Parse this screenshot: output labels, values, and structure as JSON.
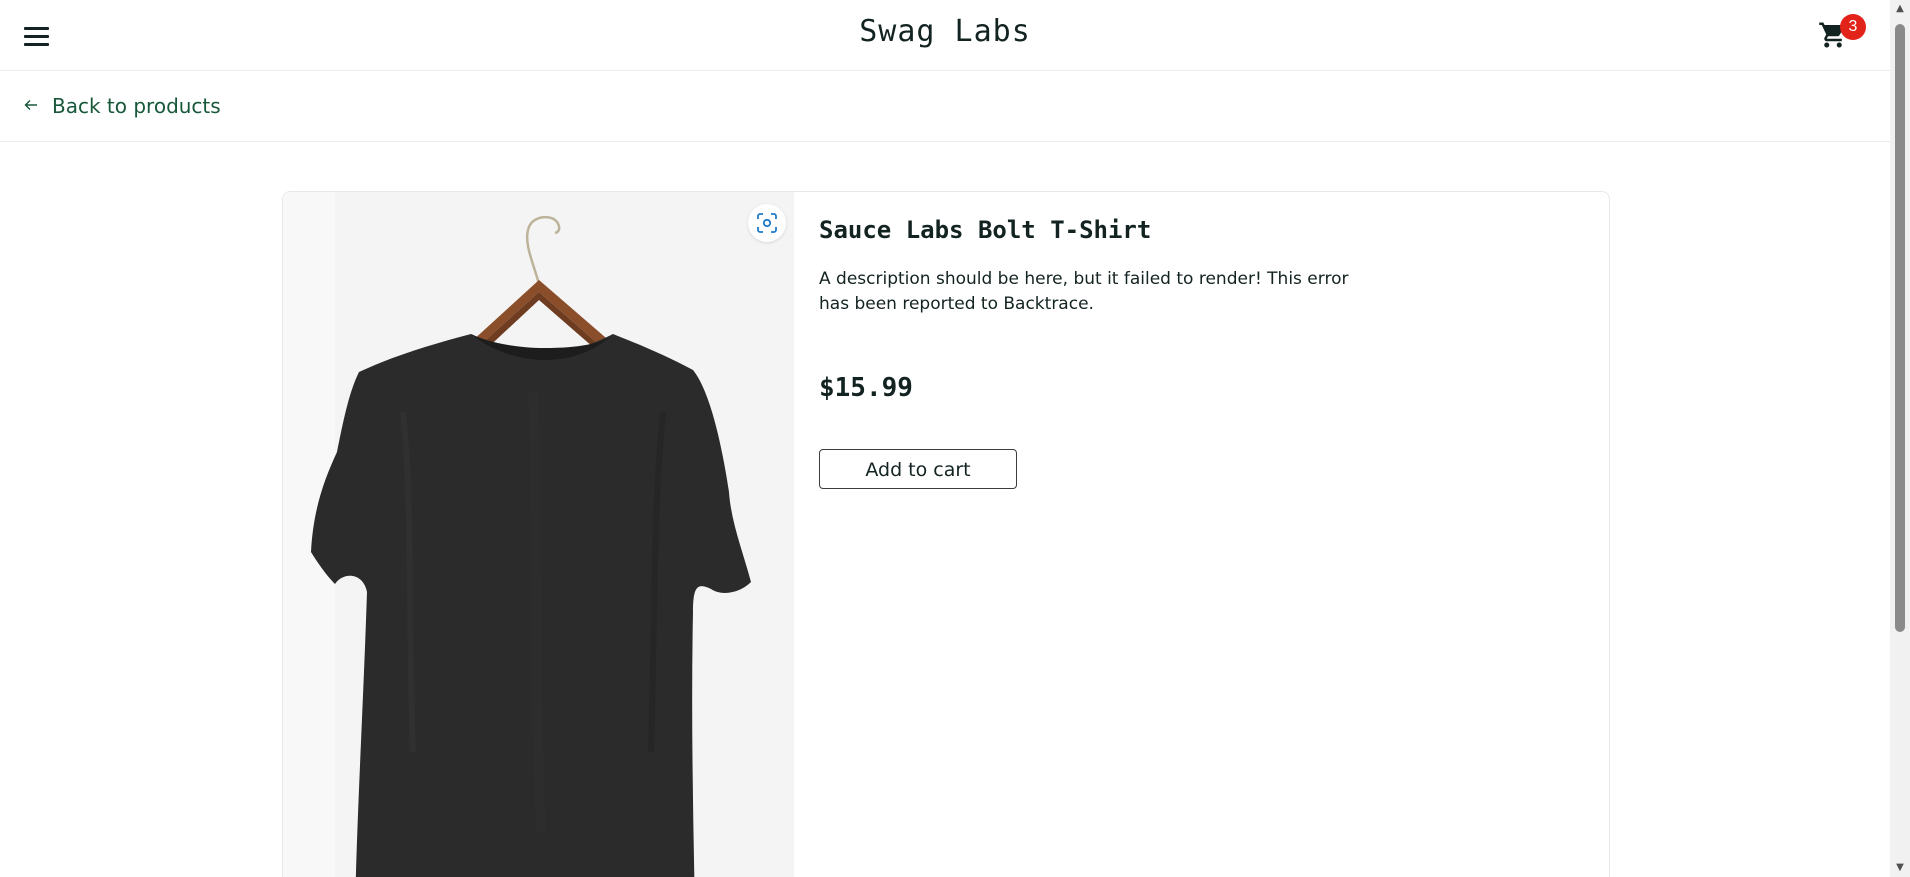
{
  "header": {
    "menu_icon": "hamburger-icon",
    "title": "Swag Labs",
    "cart_icon": "shopping-cart-icon",
    "cart_count": "3",
    "badge_color": "#e2231a"
  },
  "sub_header": {
    "back_icon": "arrow-left-icon",
    "back_label": "Back to products",
    "link_color": "#18583a"
  },
  "product": {
    "name": "Sauce Labs Bolt T-Shirt",
    "description": "A description should be here, but it failed to render! This error has been reported to Backtrace.",
    "price": "$15.99",
    "add_to_cart_label": "Add to cart",
    "image_alt": "black t-shirt on wooden hanger",
    "zoom_icon": "screenshot-focus-icon",
    "zoom_icon_color": "#1f7ac9"
  }
}
